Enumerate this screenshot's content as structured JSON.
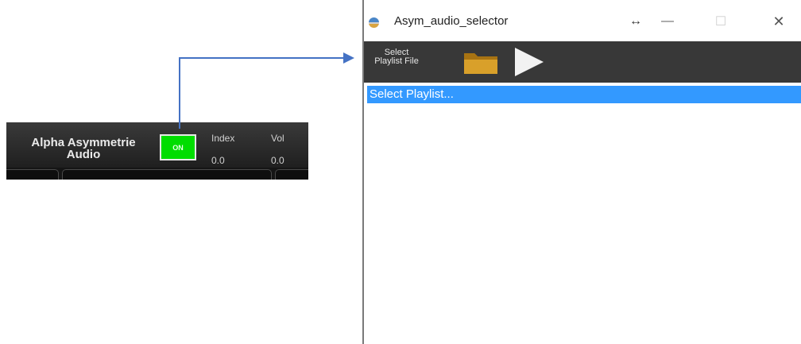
{
  "module_panel": {
    "title_line1": "Alpha Asymmetrie",
    "title_line2": "Audio",
    "power_button": "ON",
    "params": [
      {
        "label": "Index",
        "value": "0.0"
      },
      {
        "label": "Vol",
        "value": "0.0"
      }
    ]
  },
  "window": {
    "title": "Asym_audio_selector",
    "title_icon": "app-icon",
    "buttons": {
      "resize": "↔",
      "minimize": "—",
      "maximize": "☐",
      "close": "✕"
    },
    "toolbar": {
      "select_label_line1": "Select",
      "select_label_line2": "Playlist File",
      "folder_icon": "folder-icon",
      "play_icon": "play-icon"
    },
    "list": {
      "items": [
        "Select Playlist..."
      ]
    }
  },
  "colors": {
    "on_green": "#00dd00",
    "arrow_blue": "#4472c4",
    "selection_blue": "#3399ff",
    "toolbar_bg": "#383838",
    "folder": "#c8901a"
  }
}
